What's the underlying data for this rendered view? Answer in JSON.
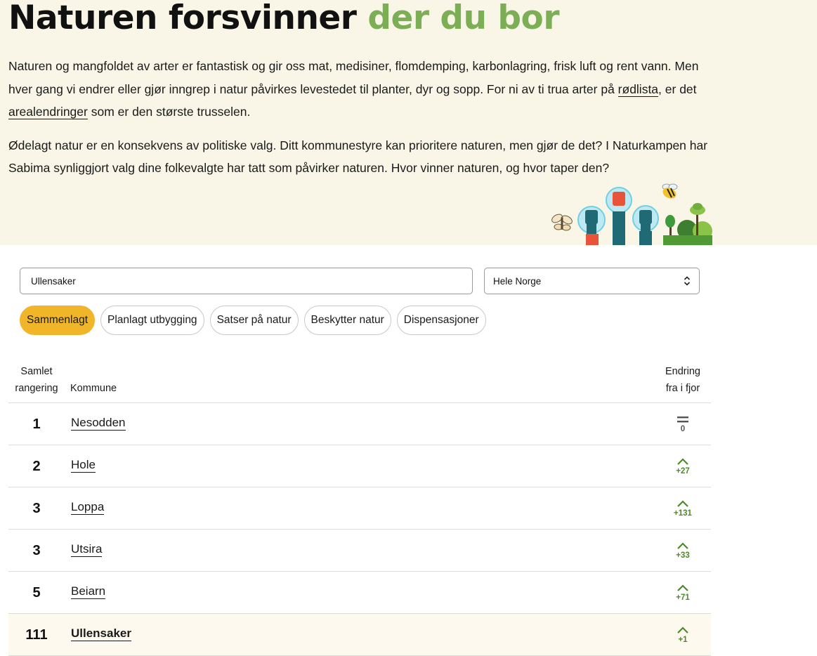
{
  "hero": {
    "title_main": "Naturen forsvinner",
    "title_accent": "der du bor",
    "para1_part1": "Naturen og mangfoldet av arter er fantastisk og gir oss mat, medisiner, flomdemping, karbonlagring, frisk luft og rent vann. Men hver gang vi endrer eller gjør inngrep i natur påvirkes levestedet til planter, dyr og sopp. For ni av ti trua arter på ",
    "para1_link1": "rødlista",
    "para1_part2": ", er det ",
    "para1_link2": "arealendringer",
    "para1_part3": " som er den største trusselen.",
    "para2": "Ødelagt natur er en konsekvens av politiske valg. Ditt kommunestyre kan prioritere naturen, men gjør de det? I Naturkampen har Sabima synliggjort valg dine folkevalgte har tatt som påvirker naturen. Hvor vinner naturen, og hvor taper den?"
  },
  "filters": {
    "search_value": "Ullensaker",
    "region_selected": "Hele Norge",
    "tabs": [
      {
        "label": "Sammenlagt",
        "active": true
      },
      {
        "label": "Planlagt utbygging",
        "active": false
      },
      {
        "label": "Satser på natur",
        "active": false
      },
      {
        "label": "Beskytter natur",
        "active": false
      },
      {
        "label": "Dispensasjoner",
        "active": false
      }
    ]
  },
  "table": {
    "headers": {
      "rank_line1": "Samlet",
      "rank_line2": "rangering",
      "name": "Kommune",
      "change_line1": "Endring",
      "change_line2": "fra i fjor"
    },
    "rows": [
      {
        "rank": "1",
        "name": "Nesodden",
        "change": "0",
        "direction": "same",
        "highlight": false
      },
      {
        "rank": "2",
        "name": "Hole",
        "change": "+27",
        "direction": "up",
        "highlight": false
      },
      {
        "rank": "3",
        "name": "Loppa",
        "change": "+131",
        "direction": "up",
        "highlight": false
      },
      {
        "rank": "3",
        "name": "Utsira",
        "change": "+33",
        "direction": "up",
        "highlight": false
      },
      {
        "rank": "5",
        "name": "Beiarn",
        "change": "+71",
        "direction": "up",
        "highlight": false
      },
      {
        "rank": "111",
        "name": "Ullensaker",
        "change": "+1",
        "direction": "up",
        "highlight": true
      }
    ]
  },
  "colors": {
    "accent_green": "#7cae55",
    "active_tab": "#f1b52a",
    "hero_background": "#f9f6e8",
    "change_up": "#4d8a2a"
  },
  "icons": {
    "same": "equals-icon",
    "up": "chevron-up-icon",
    "select": "chevron-up-down-icon",
    "illustration": "raised-fists-nature-illustration"
  }
}
